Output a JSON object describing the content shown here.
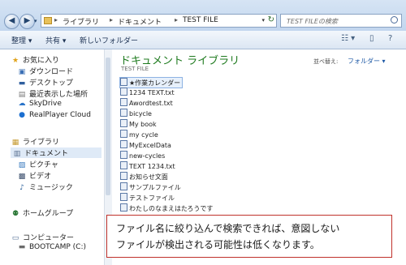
{
  "window": {
    "minimize": "–",
    "maximize": "□",
    "close": "x"
  },
  "nav_buttons": {
    "back": "◀",
    "forward": "▶"
  },
  "address": {
    "crumbs": [
      "ライブラリ",
      "ドキュメント",
      "TEST FILE"
    ],
    "separator": "▸"
  },
  "search": {
    "placeholder": "TEST FILEの検索"
  },
  "toolbar": {
    "organize": "整理 ▾",
    "share": "共有 ▾",
    "new_folder": "新しいフォルダー"
  },
  "sidebar": {
    "favorites_label": "お気に入り",
    "favorites": [
      "ダウンロード",
      "デスクトップ",
      "最近表示した場所",
      "SkyDrive",
      "RealPlayer Cloud"
    ],
    "libraries_label": "ライブラリ",
    "libraries": [
      "ドキュメント",
      "ピクチャ",
      "ビデオ",
      "ミュージック"
    ],
    "homegroup": "ホームグループ",
    "computer_label": "コンピューター",
    "drives": [
      "BOOTCAMP (C:)"
    ]
  },
  "library": {
    "title": "ドキュメント ライブラリ",
    "subtitle": "TEST FILE",
    "arrange_label": "並べ替え:",
    "arrange_value": "フォルダー ▾"
  },
  "files": [
    "★作業カレンダー",
    "1234 TEXT.txt",
    "Awordtest.txt",
    "bicycle",
    "My book",
    "my cycle",
    "MyExcelData",
    "new-cycles",
    "TEXT 1234.txt",
    "お知らせ文面",
    "サンプルファイル",
    "テストファイル",
    "わたしのなまえはたろうです"
  ],
  "callout": {
    "line1": "ファイル名に絞り込んで検索できれば、意図しない",
    "line2": "ファイルが検出される可能性は低くなります。"
  },
  "colors": {
    "library_title": "#1e7a1e",
    "callout_border": "#c0312b",
    "link": "#1f5aa6"
  }
}
